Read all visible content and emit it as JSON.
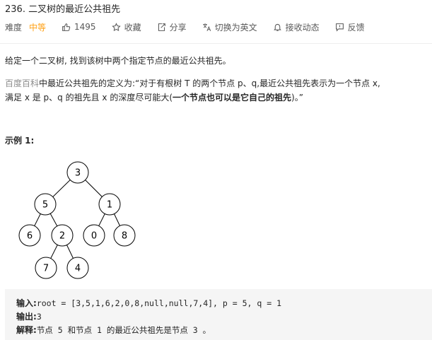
{
  "problem": {
    "title": "236. 二叉树的最近公共祖先",
    "difficulty_label": "难度",
    "difficulty": "中等",
    "likes": "1495",
    "favorite": "收藏",
    "share": "分享",
    "switch_lang": "切换为英文",
    "notify": "接收动态",
    "feedback": "反馈"
  },
  "description": {
    "p1": "给定一个二叉树, 找到该树中两个指定节点的最近公共祖先。",
    "link": "百度百科",
    "p2_a": "中最近公共祖先的定义为:“对于有根树 T 的两个节点 p、q,最近公共祖先表示为一个节点 x,",
    "p2_b": "满足 x 是 p、q 的祖先且 x 的深度尽可能大(",
    "p2_bold": "一个节点也可以是它自己的祖先",
    "p2_c": ")。”"
  },
  "example": {
    "title": "示例 1:",
    "tree_nodes": [
      "3",
      "5",
      "1",
      "6",
      "2",
      "0",
      "8",
      "7",
      "4"
    ],
    "input_label": "输入:",
    "input_value": "root = [3,5,1,6,2,0,8,null,null,7,4], p = 5, q = 1",
    "output_label": "输出:",
    "output_value": "3",
    "explain_label": "解释:",
    "explain_value": "节点 5 和节点 1 的最近公共祖先是节点 3 。"
  },
  "icons": [
    "thumbs-up-icon",
    "star-icon",
    "share-icon",
    "translate-icon",
    "bell-icon",
    "feedback-icon"
  ],
  "colors": {
    "difficulty": "#ffa116",
    "link": "#8c8c8c",
    "code_bg": "#f5f5f5"
  }
}
